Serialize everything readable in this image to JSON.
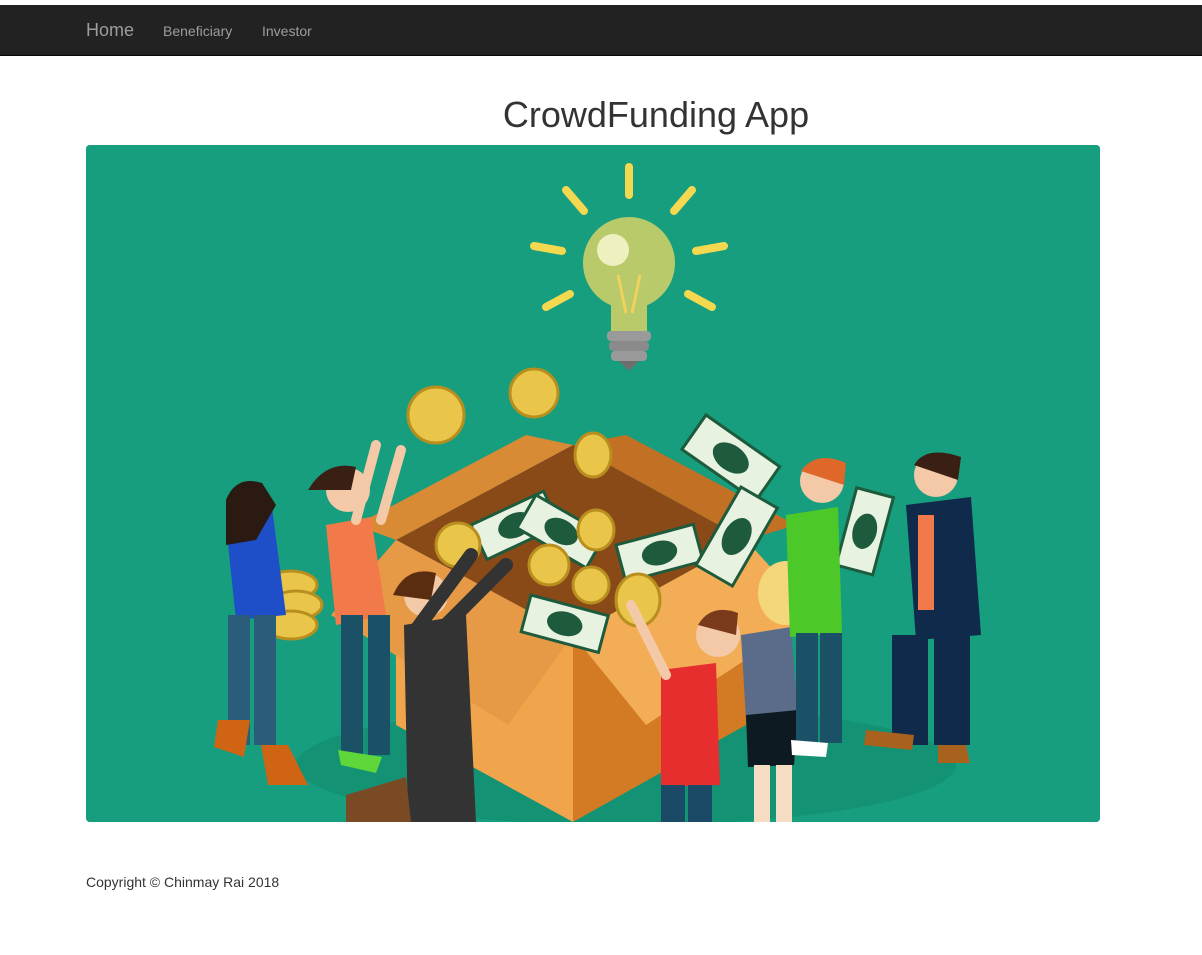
{
  "navbar": {
    "brand": "Home",
    "links": [
      {
        "label": "Beneficiary"
      },
      {
        "label": "Investor"
      }
    ]
  },
  "main": {
    "title": "CrowdFunding App",
    "hero_image": {
      "subject": "crowdfunding-illustration",
      "background_color": "#169e7e"
    }
  },
  "footer": {
    "copyright": "Copyright © Chinmay Rai 2018"
  },
  "colors": {
    "navbar_bg": "#222222",
    "navbar_text": "#9d9d9d",
    "hero_bg": "#169e7e",
    "box_orange": "#e8923a",
    "coin_gold": "#e9c64a",
    "bill_green": "#1e5a3c"
  }
}
